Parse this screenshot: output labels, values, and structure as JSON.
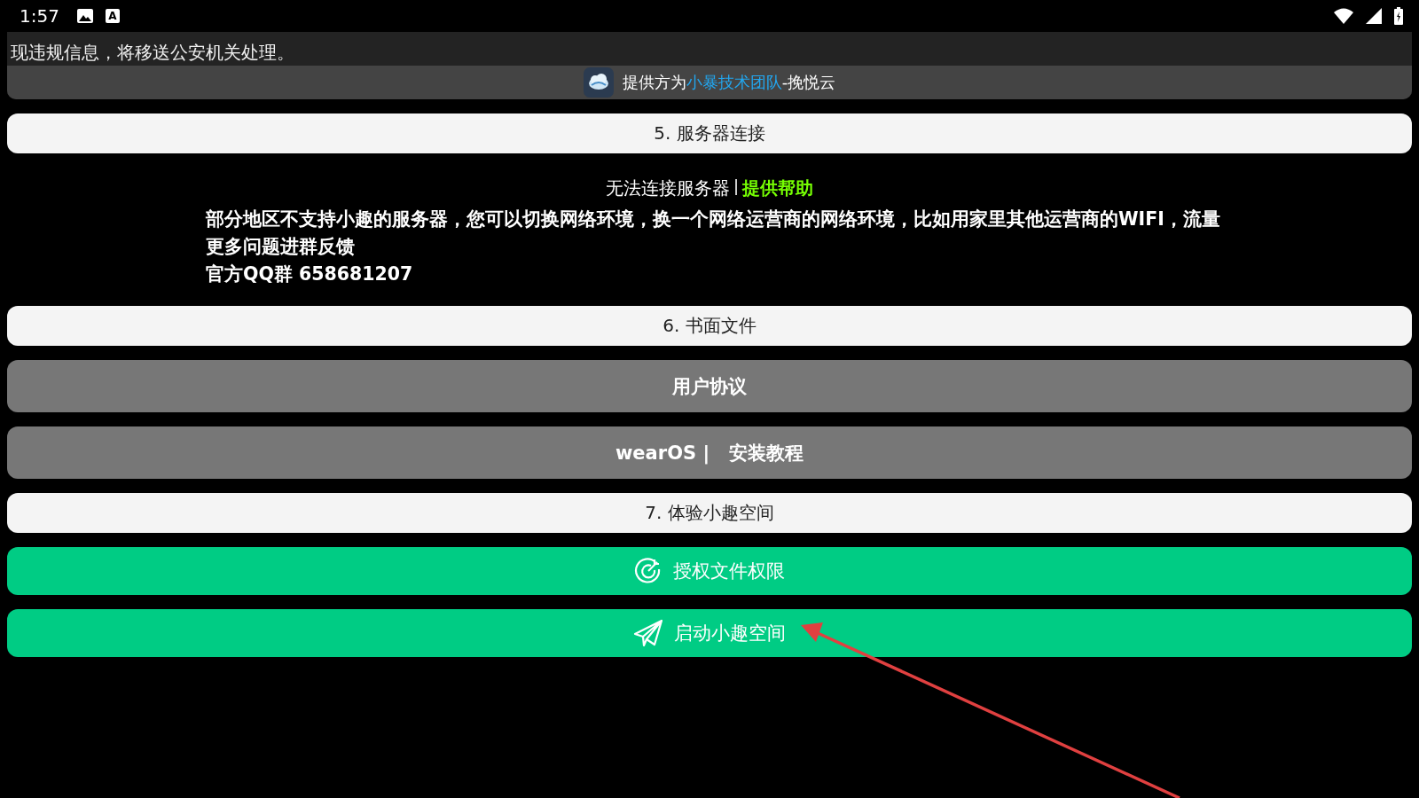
{
  "status_bar": {
    "time": "1:57",
    "notification_letter": "A"
  },
  "notice": {
    "text": "现违规信息，将移送公安机关处理。",
    "provider": {
      "prefix": "提供方为",
      "link": "小暴技术团队",
      "suffix": "-挽悦云"
    }
  },
  "items": [
    {
      "kind": "header",
      "label": "5. 服务器连接"
    },
    {
      "kind": "help",
      "title": "无法连接服务器",
      "separator": "|",
      "link": "提供帮助",
      "lines": [
        "部分地区不支持小趣的服务器，您可以切换网络环境，换一个网络运营商的网络环境，比如用家里其他运营商的WIFI，流量",
        "更多问题进群反馈",
        "官方QQ群 658681207"
      ]
    },
    {
      "kind": "header",
      "label": "6. 书面文件"
    },
    {
      "kind": "gray",
      "label": "用户协议"
    },
    {
      "kind": "gray",
      "label": "wearOS |   安装教程"
    },
    {
      "kind": "header",
      "label": "7. 体验小趣空间"
    },
    {
      "kind": "green",
      "label": "授权文件权限"
    },
    {
      "kind": "green",
      "label": "启动小趣空间"
    }
  ]
}
